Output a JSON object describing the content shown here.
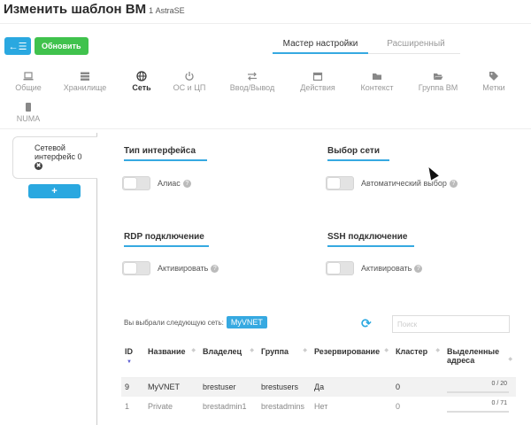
{
  "header": {
    "title": "Изменить шаблон ВМ",
    "subtitle": "1 AstraSE"
  },
  "toolbar": {
    "back_icon": "←☰",
    "update_label": "Обновить"
  },
  "modes": {
    "wizard": "Мастер настройки",
    "advanced": "Расширенный"
  },
  "tabs": [
    {
      "label": "Общие",
      "icon": "laptop-icon"
    },
    {
      "label": "Хранилище",
      "icon": "storage-icon"
    },
    {
      "label": "Сеть",
      "icon": "globe-icon"
    },
    {
      "label": "ОС и ЦП",
      "icon": "power-icon"
    },
    {
      "label": "Ввод/Вывод",
      "icon": "exchange-icon"
    },
    {
      "label": "Действия",
      "icon": "calendar-icon"
    },
    {
      "label": "Контекст",
      "icon": "folder-icon"
    },
    {
      "label": "Группа ВМ",
      "icon": "folder-open-icon"
    },
    {
      "label": "Метки",
      "icon": "tag-icon"
    },
    {
      "label": "NUMA",
      "icon": "chip-icon"
    }
  ],
  "nic": {
    "label": "Сетевой интерфейс 0",
    "remove_icon": "✖",
    "add_icon": "+"
  },
  "sections": {
    "interface_type": {
      "title": "Тип интерфейса",
      "toggle_label": "Алиас"
    },
    "network_select": {
      "title": "Выбор сети",
      "toggle_label": "Автоматический выбор"
    },
    "rdp": {
      "title": "RDP подключение",
      "toggle_label": "Активировать"
    },
    "ssh": {
      "title": "SSH подключение",
      "toggle_label": "Активировать"
    }
  },
  "selection": {
    "prefix": "Вы выбрали следующую сеть:",
    "network": "MyVNET"
  },
  "search": {
    "placeholder": "Поиск",
    "value": ""
  },
  "refresh_icon": "⟳",
  "help_icon": "?",
  "table": {
    "columns": [
      "ID",
      "Название",
      "Владелец",
      "Группа",
      "Резервирование",
      "Кластер",
      "Выделенные адреса"
    ],
    "rows": [
      {
        "id": "9",
        "name": "MyVNET",
        "owner": "brestuser",
        "group": "brestusers",
        "reservation": "Да",
        "cluster": "0",
        "leases": "0 / 20",
        "leases_fraction": 0
      },
      {
        "id": "1",
        "name": "Private",
        "owner": "brestadmin1",
        "group": "brestadmins",
        "reservation": "Нет",
        "cluster": "0",
        "leases": "0 / 71",
        "leases_fraction": 0
      }
    ]
  },
  "colors": {
    "accent": "#36a9e1",
    "update": "#40c24d",
    "sort_active": "#5a5bd1"
  }
}
